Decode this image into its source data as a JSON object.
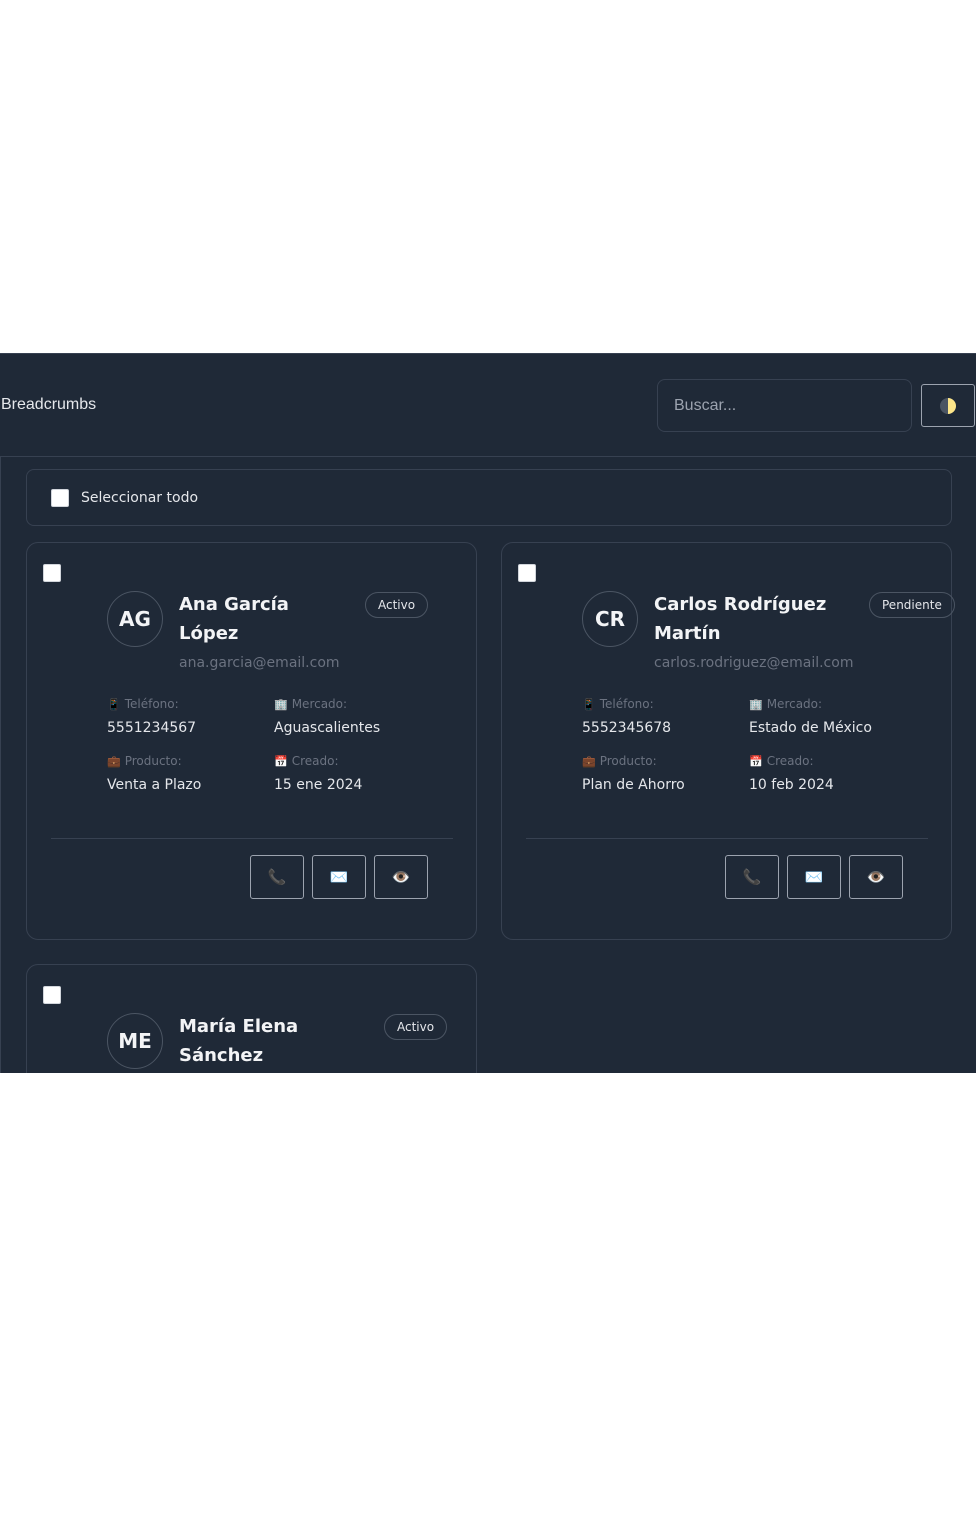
{
  "header": {
    "breadcrumbs": "Breadcrumbs",
    "search_placeholder": "Buscar...",
    "theme_icon": "half-moon-icon"
  },
  "select_all": {
    "label": "Seleccionar todo"
  },
  "field_labels": {
    "phone": "Teléfono:",
    "market": "Mercado:",
    "product": "Producto:",
    "created": "Creado:"
  },
  "field_icons": {
    "phone": "📱",
    "market": "🏢",
    "product": "💼",
    "created": "📅"
  },
  "action_icons": {
    "call": "📞",
    "email": "✉️",
    "view": "👁️"
  },
  "clients": [
    {
      "initials": "AG",
      "name": "Ana García López",
      "status": "Activo",
      "email": "ana.garcia@email.com",
      "phone": "5551234567",
      "market": "Aguascalientes",
      "product": "Venta a Plazo",
      "created": "15 ene 2024"
    },
    {
      "initials": "CR",
      "name": "Carlos Rodríguez Martín",
      "status": "Pendiente",
      "email": "carlos.rodriguez@email.com",
      "phone": "5552345678",
      "market": "Estado de México",
      "product": "Plan de Ahorro",
      "created": "10 feb 2024"
    },
    {
      "initials": "ME",
      "name": "María Elena Sánchez",
      "status": "Activo"
    }
  ]
}
